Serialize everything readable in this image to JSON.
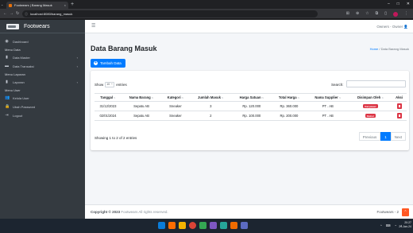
{
  "browser": {
    "tab_title": "Footwears | Barang Masuk",
    "tab_close": "×",
    "new_tab": "+",
    "url": "localhost:8080/barang_masuk",
    "win_controls": [
      "–",
      "□",
      "✕"
    ]
  },
  "sidebar": {
    "brand": "Footwears",
    "items": [
      {
        "type": "item",
        "label": "Dashboard",
        "icon": "dashboard-icon",
        "glyph": "◉"
      },
      {
        "type": "header",
        "label": "Menu Data"
      },
      {
        "type": "item",
        "label": "Data Master",
        "icon": "file-icon",
        "glyph": "▮",
        "chevron": "‹"
      },
      {
        "type": "item",
        "label": "Data Transaksi",
        "icon": "keyboard-icon",
        "glyph": "▬",
        "chevron": "‹"
      },
      {
        "type": "header",
        "label": "Menu Laporan"
      },
      {
        "type": "item",
        "label": "Laporan",
        "icon": "file-icon",
        "glyph": "▮",
        "chevron": "‹"
      },
      {
        "type": "header",
        "label": "Menu User"
      },
      {
        "type": "item",
        "label": "Kelola User",
        "icon": "users-icon",
        "glyph": "👥"
      },
      {
        "type": "item",
        "label": "Ubah Password",
        "icon": "lock-icon",
        "glyph": "🔒"
      },
      {
        "type": "item",
        "label": "Logout",
        "icon": "logout-icon",
        "glyph": "⇥"
      }
    ]
  },
  "topnav": {
    "user": "Owners - Owner"
  },
  "page": {
    "title": "Data Barang Masuk",
    "breadcrumb_home": "Home",
    "breadcrumb_sep": "/",
    "breadcrumb_current": "Data Barang Masuk",
    "add_button": "Tambah Data"
  },
  "table": {
    "show_label": "Show",
    "entries_value": "10",
    "entries_label": "entries",
    "search_label": "Search:",
    "search_value": "",
    "columns": [
      "Tanggal",
      "Nama Barang",
      "Kategori",
      "Jumlah Masuk",
      "Harga Satuan",
      "Total Harga",
      "Nama Supplier",
      "Disimpan Oleh",
      "Aksi"
    ],
    "rows": [
      {
        "tanggal": "31/12/2023",
        "nama": "Sepatu AB",
        "kategori": "Sneaker",
        "jumlah": "3",
        "harga": "Rp. 120.000",
        "total": "Rp. 360.000",
        "supplier": "PT . AB",
        "oleh": "Karyawan"
      },
      {
        "tanggal": "02/01/2024",
        "nama": "Sepatu AB",
        "kategori": "Sneaker",
        "jumlah": "2",
        "harga": "Rp. 100.000",
        "total": "Rp. 200.000",
        "supplier": "PT . AB",
        "oleh": "Owner"
      }
    ],
    "info": "Showing 1 to 2 of 2 entries",
    "pager": {
      "prev": "Previous",
      "page": "1",
      "next": "Next"
    }
  },
  "footer": {
    "copyright_bold": "Copyright © 2023",
    "copyright_rest": " Footwears All rights reserved.",
    "right": "Footwears - 2"
  },
  "taskbar": {
    "time": "20:27",
    "date": "29-Jan-24"
  },
  "colors": {
    "primary": "#007bff",
    "danger": "#dc3545",
    "sidebar": "#343a40"
  }
}
